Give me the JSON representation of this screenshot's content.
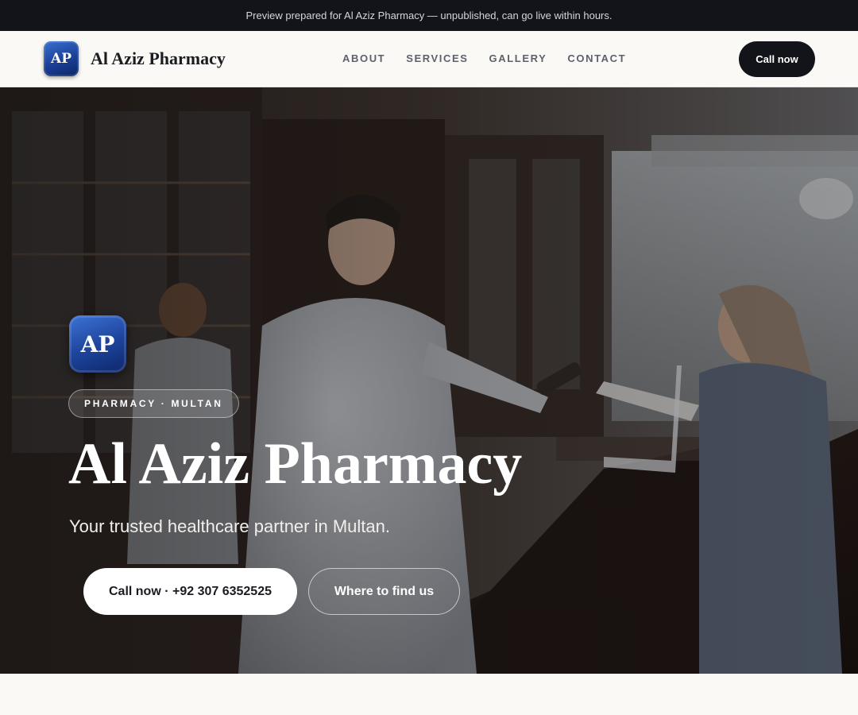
{
  "banner": {
    "text": "Preview prepared for Al Aziz Pharmacy — unpublished, can go live within hours."
  },
  "header": {
    "logo_text": "AP",
    "brand": "Al Aziz Pharmacy",
    "nav": [
      {
        "label": "ABOUT"
      },
      {
        "label": "SERVICES"
      },
      {
        "label": "GALLERY"
      },
      {
        "label": "CONTACT"
      }
    ],
    "cta": "Call now"
  },
  "hero": {
    "logo_text": "AP",
    "tag": "PHARMACY · MULTAN",
    "title": "Al Aziz Pharmacy",
    "subtitle": "Your trusted healthcare partner in Multan.",
    "primary_button": "Call now · +92 307 6352525",
    "secondary_button": "Where to find us",
    "background_image": "pharmacy interior with pharmacist handing a bottle to a customer at the counter"
  },
  "colors": {
    "dark": "#121419",
    "page": "#faf9f5",
    "logo_blue": "#1c4299",
    "nav_text": "#5c616c"
  }
}
